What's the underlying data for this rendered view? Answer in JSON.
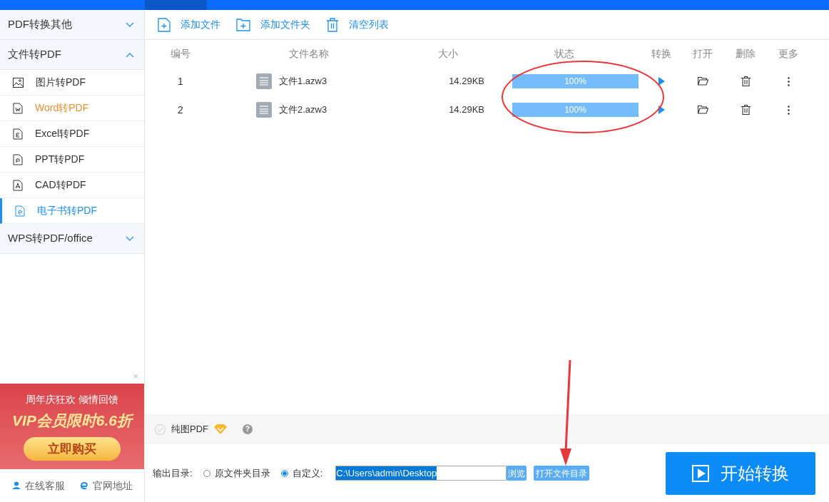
{
  "sidebar": {
    "groups": [
      {
        "label": "PDF转换其他",
        "expanded": false
      },
      {
        "label": "文件转PDF",
        "expanded": true,
        "items": [
          {
            "label": "图片转PDF",
            "kind": "image",
            "selected": false,
            "hovered": false
          },
          {
            "label": "Word转PDF",
            "kind": "word",
            "selected": false,
            "hovered": true
          },
          {
            "label": "Excel转PDF",
            "kind": "excel",
            "selected": false,
            "hovered": false
          },
          {
            "label": "PPT转PDF",
            "kind": "ppt",
            "selected": false,
            "hovered": false
          },
          {
            "label": "CAD转PDF",
            "kind": "cad",
            "selected": false,
            "hovered": false
          },
          {
            "label": "电子书转PDF",
            "kind": "ebook",
            "selected": true,
            "hovered": false
          }
        ]
      },
      {
        "label": "WPS转PDF/office",
        "expanded": false
      }
    ],
    "ad": {
      "close": "×",
      "line1": "周年庆狂欢 倾情回馈",
      "line2": "VIP会员限时6.6折",
      "button": "立即购买"
    },
    "links": [
      {
        "label": "在线客服",
        "kind": "service"
      },
      {
        "label": "官网地址",
        "kind": "web"
      }
    ]
  },
  "toolbar": [
    {
      "label": "添加文件",
      "kind": "file"
    },
    {
      "label": "添加文件夹",
      "kind": "folder"
    },
    {
      "label": "清空列表",
      "kind": "trash"
    }
  ],
  "table": {
    "columns": [
      "编号",
      "文件名称",
      "大小",
      "状态",
      "转换",
      "打开",
      "删除",
      "更多"
    ],
    "rows": [
      {
        "index": "1",
        "name": "文件1.azw3",
        "size": "14.29KB",
        "level": 1,
        "progress": "100%"
      },
      {
        "index": "2",
        "name": "文件2.azw3",
        "size": "14.29KB",
        "level": 1,
        "progress": "100%"
      }
    ]
  },
  "options": {
    "pure_image_pdf": {
      "label": "纯图PDF",
      "checked": false
    },
    "help": "?"
  },
  "output": {
    "label": "输出目录:",
    "radios": [
      {
        "label": "原文件夹目录",
        "selected": false
      },
      {
        "label": "自定义:",
        "selected": true
      }
    ],
    "path": "C:\\Users\\admin\\Desktop",
    "path_selected": true,
    "browse": "浏览",
    "open_dir": "打开文件目录"
  },
  "start_button": "开始转换"
}
